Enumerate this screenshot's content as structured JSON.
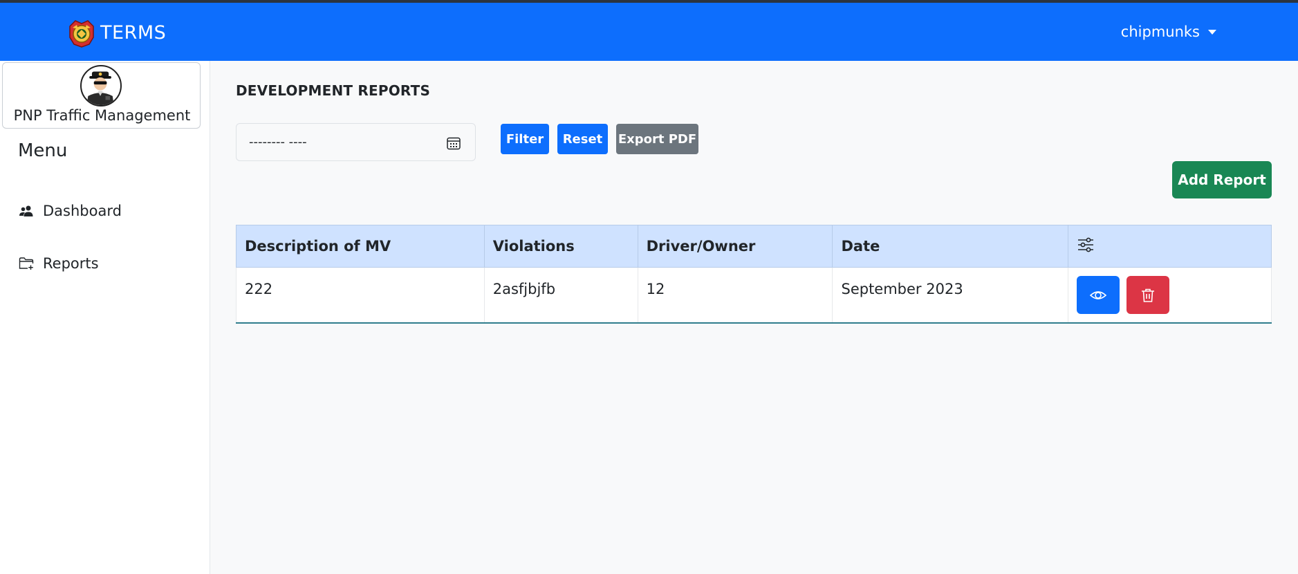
{
  "header": {
    "app_name": "TERMS",
    "username": "chipmunks"
  },
  "sidebar": {
    "profile_name": "PNP Traffic Management",
    "menu_title": "Menu",
    "items": [
      {
        "label": "Dashboard",
        "icon": "people-icon"
      },
      {
        "label": "Reports",
        "icon": "folder-plus-icon"
      }
    ]
  },
  "main": {
    "title": "DEVELOPMENT REPORTS",
    "month_input": {
      "value": "-------- ----",
      "icon": "calendar-icon"
    },
    "buttons": {
      "filter": "Filter",
      "reset": "Reset",
      "export_pdf": "Export PDF",
      "add_report": "Add Report"
    },
    "table": {
      "columns": [
        "Description of MV",
        "Violations",
        "Driver/Owner",
        "Date"
      ],
      "settings_icon": "sliders-icon",
      "rows": [
        {
          "description": "222",
          "violations": "2asfjbjfb",
          "driver_owner": "12",
          "date": "September 2023"
        }
      ]
    }
  },
  "colors": {
    "primary": "#0d6efd",
    "secondary": "#6c757d",
    "success": "#198754",
    "danger": "#dc3545",
    "table_header": "#cfe2ff"
  }
}
